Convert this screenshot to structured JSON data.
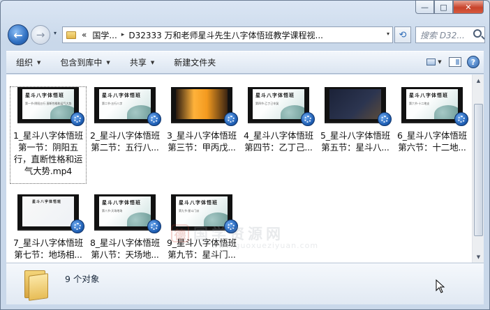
{
  "window": {
    "minimize": "—",
    "maximize": "□",
    "close": "✕"
  },
  "nav": {
    "back_glyph": "←",
    "forward_glyph": "→",
    "history_glyph": "▾",
    "breadcrumb": [
      "«",
      "国学...",
      "D32333 万和老师星斗先生八字体悟班教学课程视..."
    ],
    "breadcrumb_sep": "▸",
    "address_dropdown": "▾",
    "refresh_glyph": "⟲",
    "search_placeholder": "搜索 D32..."
  },
  "toolbar": {
    "organize": "组织",
    "include_library": "包含到库中",
    "share": "共享",
    "new_folder": "新建文件夹",
    "help": "?"
  },
  "files": [
    {
      "name": "1_星斗八字体悟班第一节：阴阳五行，直断性格和运气大势.mp4",
      "short": "1_星斗八字体悟班第一节：阴阳五行，直断性格和运气大势.mp4",
      "title": "星斗八字体悟班",
      "subtitle": "第一节·阴阳五行 直断性格和运气大势",
      "style": "light-green",
      "selected": true
    },
    {
      "name": "2_星斗八字体悟班第二节：五行八...",
      "line1": "2_星斗八字体悟班",
      "line2": "第二节：五行八...",
      "title": "星斗八字体悟班",
      "subtitle": "第二节·五行八字",
      "style": "light-green"
    },
    {
      "name": "3_星斗八字体悟班第三节：甲丙戊...",
      "line1": "3_星斗八字体悟班",
      "line2": "第三节：甲丙戊...",
      "title": "",
      "subtitle": "",
      "style": "orange"
    },
    {
      "name": "4_星斗八字体悟班第四节：乙丁己...",
      "line1": "4_星斗八字体悟班",
      "line2": "第四节：乙丁己...",
      "title": "星斗八字体悟班",
      "subtitle": "第四节·乙丁己辛癸",
      "style": "light-green"
    },
    {
      "name": "5_星斗八字体悟班第五节：星斗八...",
      "line1": "5_星斗八字体悟班",
      "line2": "第五节：星斗八...",
      "title": "星斗八字体悟班",
      "subtitle": "第五节·星斗八字",
      "style": "dark"
    },
    {
      "name": "6_星斗八字体悟班第六节：十二地...",
      "line1": "6_星斗八字体悟班",
      "line2": "第六节：十二地...",
      "title": "星斗八字体悟班",
      "subtitle": "第六节·十二地支",
      "style": "light-green"
    },
    {
      "name": "7_星斗八字体悟班第七节：地场相...",
      "line1": "7_星斗八字体悟班",
      "line2": "第七节：地场相...",
      "title": "星斗八字体悟班",
      "subtitle": "第七节",
      "style": "light"
    },
    {
      "name": "8_星斗八字体悟班第八节：天场地...",
      "line1": "8_星斗八字体悟班",
      "line2": "第八节：天场地...",
      "title": "星斗八字体悟班",
      "subtitle": "第八节·天场地场",
      "style": "light-green"
    },
    {
      "name": "9_星斗八字体悟班第九节：星斗门...",
      "line1": "9_星斗八字体悟班",
      "line2": "第九节：星斗门...",
      "title": "星斗八字体悟班",
      "subtitle": "第九节·星斗门派",
      "style": "light-green"
    }
  ],
  "watermark": {
    "seal": "德",
    "text": "国学资源网",
    "url": "www.guoxueziyuan.com"
  },
  "details": {
    "count": "9 个对象"
  },
  "colors": {
    "accent": "#2f6fc1",
    "close": "#c8432b"
  }
}
